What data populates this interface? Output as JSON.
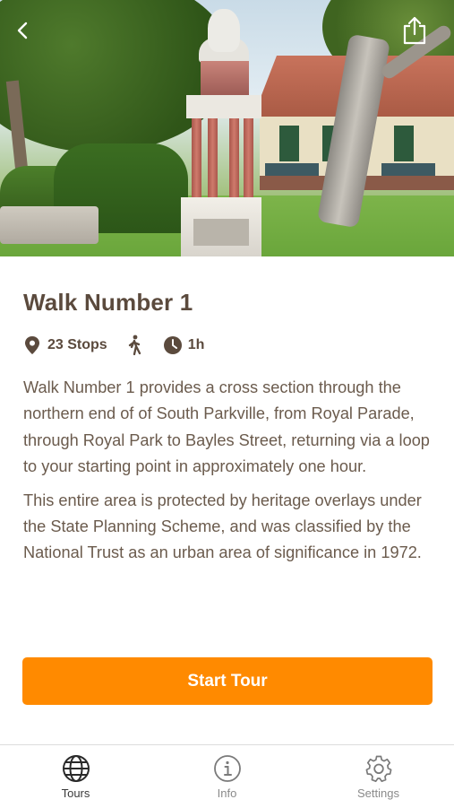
{
  "tour": {
    "title": "Walk Number 1",
    "stops": "23 Stops",
    "duration": "1h",
    "description": [
      "Walk Number 1 provides a cross section through the northern end of of South Parkville, from Royal Parade, through Royal Park to Bayles Street, returning via a loop to your starting point in approximately one hour.",
      "This entire area is protected by heritage overlays under the State Planning Scheme, and was classified by the National Trust as an urban area of significance in 1972."
    ]
  },
  "header": {
    "back_icon": "chevron-left-icon",
    "share_icon": "share-icon"
  },
  "actions": {
    "start_label": "Start Tour"
  },
  "tabbar": {
    "items": [
      {
        "label": "Tours",
        "icon": "globe-icon",
        "active": true
      },
      {
        "label": "Info",
        "icon": "info-icon",
        "active": false
      },
      {
        "label": "Settings",
        "icon": "gear-icon",
        "active": false
      }
    ]
  },
  "colors": {
    "accent": "#ff8a00",
    "text": "#5b4a3d",
    "body_text": "#6b5b4d"
  }
}
